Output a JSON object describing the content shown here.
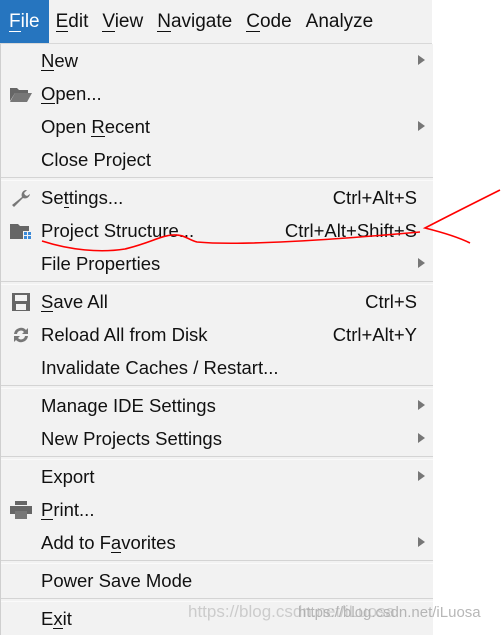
{
  "menubar": [
    {
      "label": "File",
      "mnemonic": 0,
      "active": true
    },
    {
      "label": "Edit",
      "mnemonic": 0
    },
    {
      "label": "View",
      "mnemonic": 0
    },
    {
      "label": "Navigate",
      "mnemonic": 0
    },
    {
      "label": "Code",
      "mnemonic": 0
    },
    {
      "label": "Analyze",
      "mnemonic": -1
    }
  ],
  "menu": [
    {
      "label": "New",
      "mnemonic": 0,
      "submenu": true
    },
    {
      "label": "Open...",
      "mnemonic": 0,
      "icon": "folder-open-icon"
    },
    {
      "label": "Open Recent",
      "mnemonic": 5,
      "submenu": true
    },
    {
      "label": "Close Project",
      "mnemonic": -1
    },
    {
      "sep": true
    },
    {
      "label": "Settings...",
      "mnemonic": 2,
      "icon": "wrench-icon",
      "shortcut": "Ctrl+Alt+S"
    },
    {
      "label": "Project Structure...",
      "mnemonic": -1,
      "icon": "project-structure-icon",
      "shortcut": "Ctrl+Alt+Shift+S"
    },
    {
      "label": "File Properties",
      "mnemonic": -1,
      "submenu": true
    },
    {
      "sep": true
    },
    {
      "label": "Save All",
      "mnemonic": 0,
      "icon": "save-icon",
      "shortcut": "Ctrl+S"
    },
    {
      "label": "Reload All from Disk",
      "mnemonic": -1,
      "icon": "reload-icon",
      "shortcut": "Ctrl+Alt+Y"
    },
    {
      "label": "Invalidate Caches / Restart...",
      "mnemonic": -1
    },
    {
      "sep": true
    },
    {
      "label": "Manage IDE Settings",
      "mnemonic": -1,
      "submenu": true
    },
    {
      "label": "New Projects Settings",
      "mnemonic": -1,
      "submenu": true
    },
    {
      "sep": true
    },
    {
      "label": "Export",
      "mnemonic": -1,
      "submenu": true
    },
    {
      "label": "Print...",
      "mnemonic": 0,
      "icon": "printer-icon"
    },
    {
      "label": "Add to Favorites",
      "mnemonic": 8,
      "submenu": true
    },
    {
      "sep": true
    },
    {
      "label": "Power Save Mode",
      "mnemonic": -1
    },
    {
      "sep": true
    },
    {
      "label": "Exit",
      "mnemonic": 1
    }
  ],
  "watermark": "https://blog.csdn.net/iLuosa",
  "colors": {
    "active_menu": "#2675bf",
    "menu_bg": "#f2f2f2",
    "annotation": "#ff0000"
  }
}
